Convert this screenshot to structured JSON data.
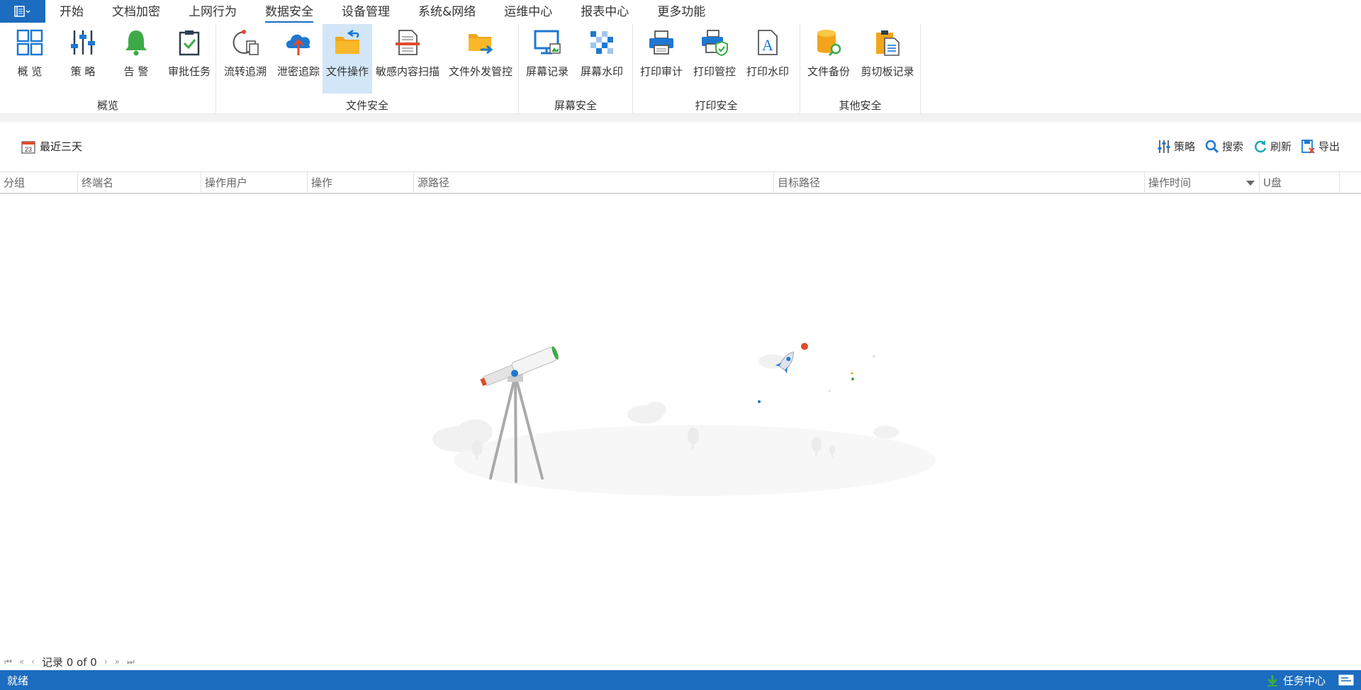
{
  "menu": {
    "tabs": [
      "开始",
      "文档加密",
      "上网行为",
      "数据安全",
      "设备管理",
      "系统&网络",
      "运维中心",
      "报表中心",
      "更多功能"
    ],
    "active_index": 3
  },
  "ribbon": {
    "groups": [
      {
        "label": "概览",
        "items": [
          "概 览",
          "策 略",
          "告 警",
          "审批任务"
        ]
      },
      {
        "label": "文件安全",
        "items": [
          "流转追溯",
          "泄密追踪",
          "文件操作",
          "敏感内容扫描",
          "文件外发管控"
        ]
      },
      {
        "label": "屏幕安全",
        "items": [
          "屏幕记录",
          "屏幕水印"
        ]
      },
      {
        "label": "打印安全",
        "items": [
          "打印审计",
          "打印管控",
          "打印水印"
        ]
      },
      {
        "label": "其他安全",
        "items": [
          "文件备份",
          "剪切板记录"
        ]
      }
    ],
    "active_item": "文件操作"
  },
  "toolbar": {
    "date_filter": "最近三天",
    "date_icon_num": "23",
    "strategy": "策略",
    "search": "搜索",
    "refresh": "刷新",
    "export": "导出"
  },
  "grid": {
    "columns": [
      "分组",
      "终端名",
      "操作用户",
      "操作",
      "源路径",
      "目标路径",
      "操作时间",
      "U盘"
    ]
  },
  "pager": {
    "record_text": "记录 0 of 0"
  },
  "status": {
    "text": "就绪",
    "task_center": "任务中心"
  },
  "colors": {
    "primary": "#1c6cbf",
    "active_bg": "#d2e6f7",
    "icon_blue": "#1e78d2",
    "icon_green": "#3daa47",
    "icon_orange": "#f2a51a"
  }
}
